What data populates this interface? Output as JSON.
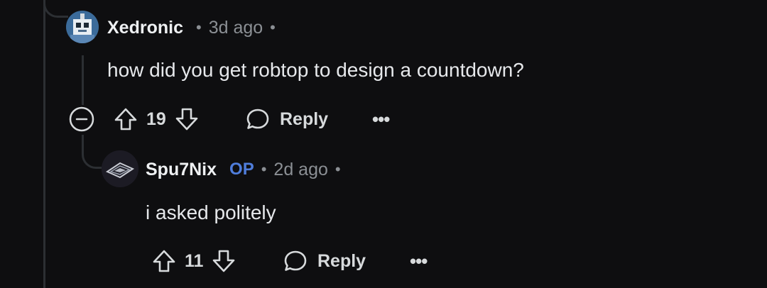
{
  "comments": [
    {
      "username": "Xedronic",
      "time": "3d ago",
      "text": "how did you get robtop to design a countdown?",
      "votes": "19",
      "reply_label": "Reply",
      "more_label": "•••"
    },
    {
      "username": "Spu7Nix",
      "badge": "OP",
      "time": "2d ago",
      "text": "i asked politely",
      "votes": "11",
      "reply_label": "Reply",
      "more_label": "•••"
    }
  ],
  "separator": "•",
  "colors": {
    "background": "#0e0e10",
    "text": "#e6e8eb",
    "muted": "#8b8f94",
    "op_badge": "#4f7ddb",
    "thread_line": "#2c2f33"
  }
}
